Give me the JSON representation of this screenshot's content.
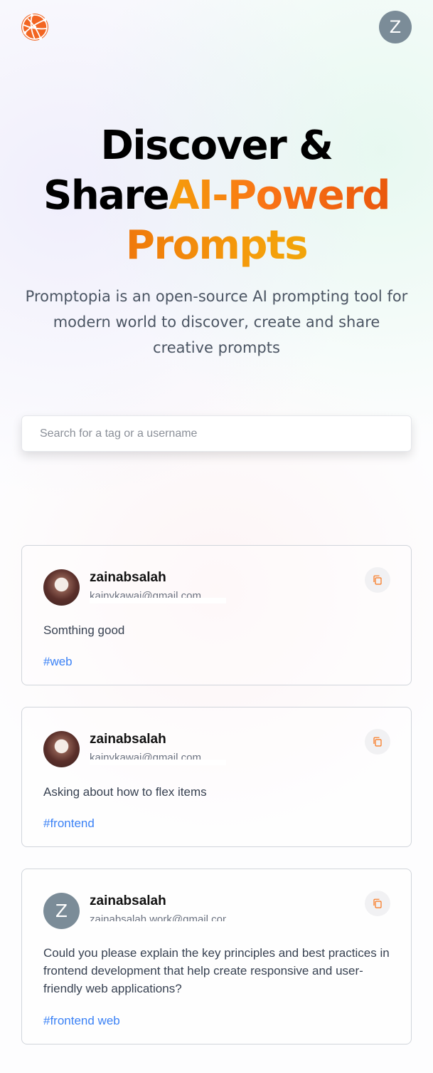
{
  "nav": {
    "logo_icon": "globe-network-icon",
    "avatar_letter": "Z",
    "avatar_color": "#7b8c98"
  },
  "hero": {
    "title_line1": "Discover &",
    "title_line2_plain": "Share",
    "title_line2_accent": "AI-Powerd",
    "title_line3": "Prompts",
    "description": "Promptopia is an open-source AI prompting tool for modern world to discover, create and share creative prompts",
    "accent_colors": [
      "#f59e0b",
      "#f97316",
      "#ea580c"
    ]
  },
  "search": {
    "placeholder": "Search for a tag or a username",
    "value": ""
  },
  "prompts": [
    {
      "username": "zainabsalah",
      "email": "kainykawai@gmail.com",
      "avatar": "photo",
      "prompt": "Somthing good",
      "tag": "#web"
    },
    {
      "username": "zainabsalah",
      "email": "kainykawai@gmail.com",
      "avatar": "photo",
      "prompt": "Asking about how to flex items",
      "tag": "#frontend"
    },
    {
      "username": "zainabsalah",
      "email": "zainabsalah.work@gmail.com",
      "avatar": "letter",
      "avatar_letter": "Z",
      "prompt": "Could you please explain the key principles and best practices in frontend development that help create responsive and user-friendly web applications?",
      "tag": "#frontend web"
    }
  ],
  "colors": {
    "tag": "#3b82f6",
    "copy_icon": "#f97316"
  }
}
